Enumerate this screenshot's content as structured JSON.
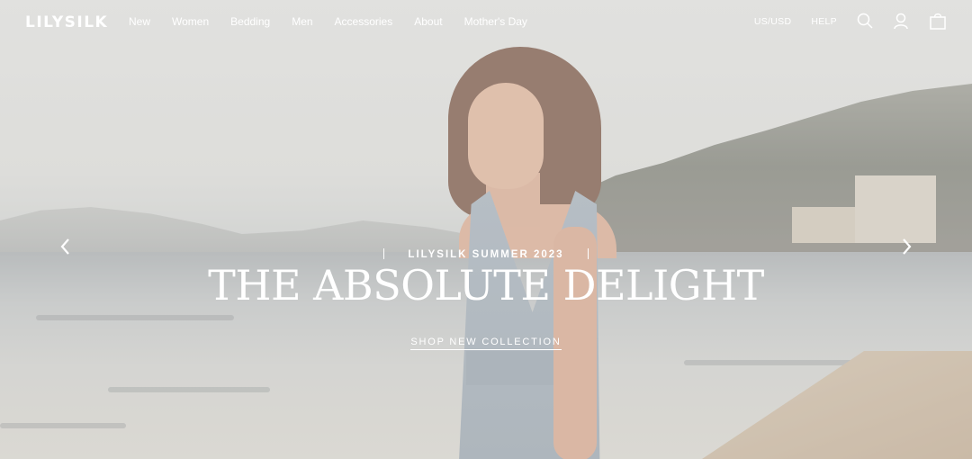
{
  "brand": {
    "logo": "LILYSILK"
  },
  "nav": {
    "items": [
      {
        "label": "New"
      },
      {
        "label": "Women"
      },
      {
        "label": "Bedding"
      },
      {
        "label": "Men"
      },
      {
        "label": "Accessories"
      },
      {
        "label": "About"
      },
      {
        "label": "Mother's Day"
      }
    ]
  },
  "utility": {
    "currency": "US/USD",
    "help": "HELP",
    "icons": [
      "search-icon",
      "account-icon",
      "bag-icon"
    ]
  },
  "hero": {
    "overline": "LILYSILK SUMMER 2023",
    "headline": "THE ABSOLUTE DELIGHT",
    "cta": "SHOP NEW COLLECTION",
    "prev_icon": "chevron-left-icon",
    "next_icon": "chevron-right-icon"
  }
}
